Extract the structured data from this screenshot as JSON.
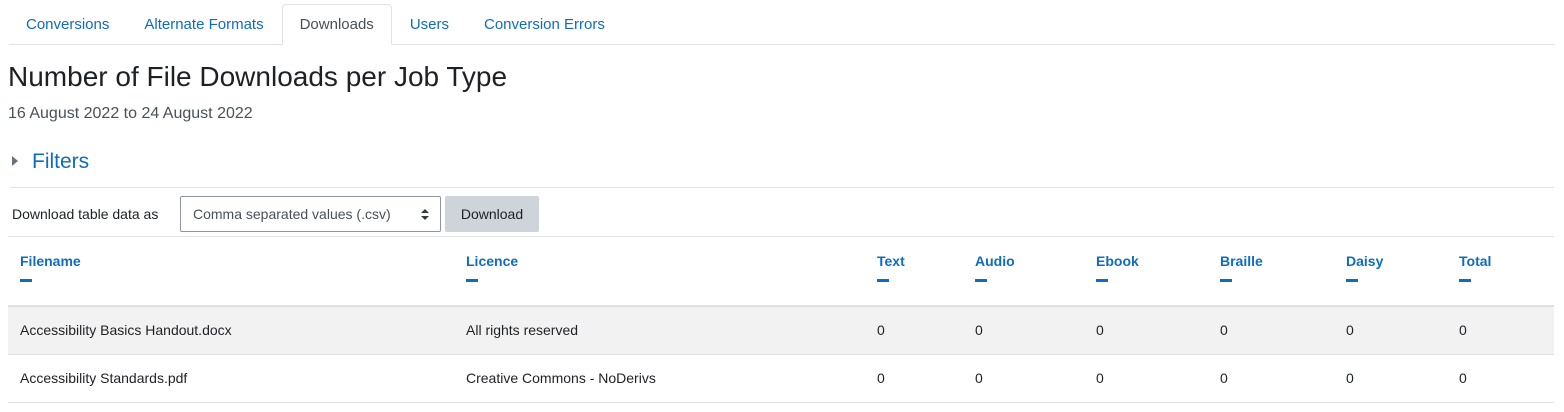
{
  "tabs": [
    {
      "label": "Conversions",
      "active": false
    },
    {
      "label": "Alternate Formats",
      "active": false
    },
    {
      "label": "Downloads",
      "active": true
    },
    {
      "label": "Users",
      "active": false
    },
    {
      "label": "Conversion Errors",
      "active": false
    }
  ],
  "page": {
    "title": "Number of File Downloads per Job Type",
    "date_range": "16 August 2022 to 24 August 2022"
  },
  "filters": {
    "label": "Filters",
    "expanded": false
  },
  "download": {
    "label": "Download table data as",
    "selected_format": "Comma separated values (.csv)",
    "button_label": "Download"
  },
  "table": {
    "columns": [
      "Filename",
      "Licence",
      "Text",
      "Audio",
      "Ebook",
      "Braille",
      "Daisy",
      "Total"
    ],
    "rows": [
      [
        "Accessibility Basics Handout.docx",
        "All rights reserved",
        "0",
        "0",
        "0",
        "0",
        "0",
        "0"
      ],
      [
        "Accessibility Standards.pdf",
        "Creative Commons - NoDerivs",
        "0",
        "0",
        "0",
        "0",
        "0",
        "0"
      ]
    ]
  },
  "colors": {
    "link": "#0f6cbf",
    "text": "#1d2125",
    "muted": "#495057",
    "border": "#dee2e6",
    "stripe": "#f2f2f2",
    "button_bg": "#ced4da"
  },
  "icons": {
    "filters_toggle": "caret-right-icon",
    "select_arrow": "up-down-arrow-icon",
    "column_toggle": "minus-icon"
  }
}
